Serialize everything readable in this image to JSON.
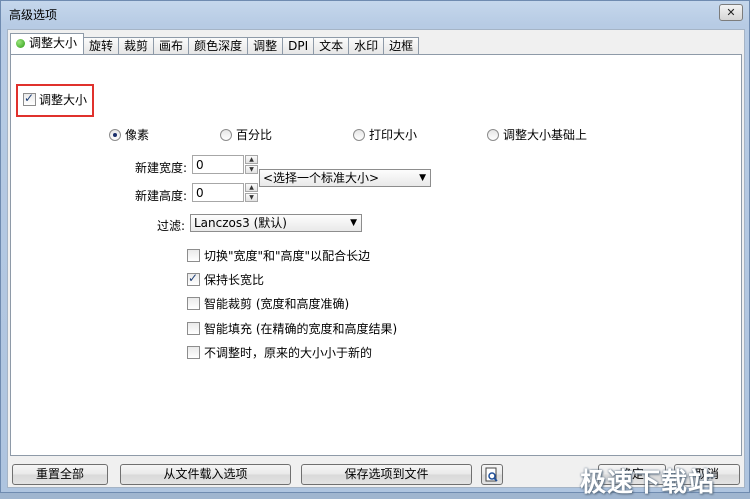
{
  "window": {
    "title": "高级选项",
    "close_glyph": "✕"
  },
  "tabs": [
    "调整大小",
    "旋转",
    "裁剪",
    "画布",
    "颜色深度",
    "调整",
    "DPI",
    "文本",
    "水印",
    "边框"
  ],
  "resize": {
    "enable_label": "调整大小",
    "enable_checked": true,
    "modes": [
      {
        "label": "像素",
        "selected": true
      },
      {
        "label": "百分比",
        "selected": false
      },
      {
        "label": "打印大小",
        "selected": false
      },
      {
        "label": "调整大小基础上",
        "selected": false
      }
    ],
    "width_label": "新建宽度:",
    "width_value": "0",
    "height_label": "新建高度:",
    "height_value": "0",
    "standard_size": "<选择一个标准大小>",
    "filter_label": "过滤:",
    "filter_value": "Lanczos3 (默认)",
    "options": [
      {
        "label": "切换\"宽度\"和\"高度\"以配合长边",
        "checked": false
      },
      {
        "label": "保持长宽比",
        "checked": true
      },
      {
        "label": "智能裁剪 (宽度和高度准确)",
        "checked": false
      },
      {
        "label": "智能填充 (在精确的宽度和高度结果)",
        "checked": false
      },
      {
        "label": "不调整时，原来的大小小于新的",
        "checked": false
      }
    ]
  },
  "footer": {
    "reset_label": "重置全部",
    "load_label": "从文件载入选项",
    "save_label": "保存选项到文件",
    "ok_label": "确定",
    "cancel_label": "取消"
  },
  "watermark": "极速下载站",
  "colors": {
    "highlight_border": "#e0312c",
    "active_tab_dot": "#2c9b16"
  }
}
